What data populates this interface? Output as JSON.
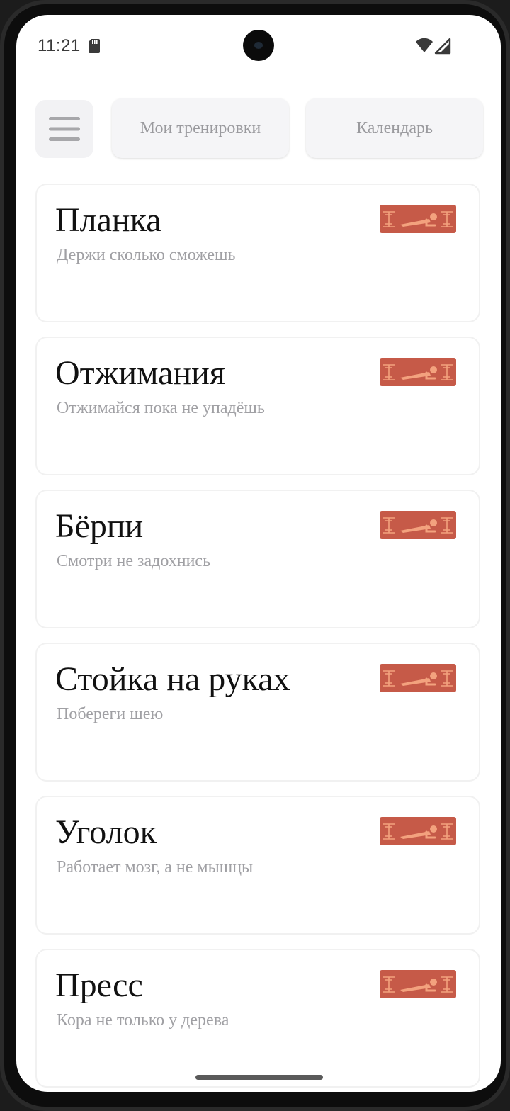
{
  "status_bar": {
    "time": "11:21",
    "icons": [
      "sd-card-icon",
      "wifi-icon",
      "signal-icon"
    ]
  },
  "nav": {
    "menu_icon": "hamburger-menu-icon",
    "tabs": [
      {
        "label": "Мои тренировки"
      },
      {
        "label": "Календарь"
      }
    ]
  },
  "colors": {
    "badge_fill": "#c65a48",
    "badge_line": "#f3a27e",
    "title": "#111111",
    "subtitle": "#a0a0a4",
    "tab_text": "#9a9a9e"
  },
  "workouts": [
    {
      "title": "Планка",
      "subtitle": "Держи сколько сможешь",
      "icon": "plank-exercise-icon"
    },
    {
      "title": "Отжимания",
      "subtitle": "Отжимайся пока не упадёшь",
      "icon": "plank-exercise-icon"
    },
    {
      "title": "Бёрпи",
      "subtitle": "Смотри не задохнись",
      "icon": "plank-exercise-icon"
    },
    {
      "title": "Стойка на руках",
      "subtitle": "Побереги шею",
      "icon": "plank-exercise-icon"
    },
    {
      "title": "Уголок",
      "subtitle": "Работает мозг, а не мышцы",
      "icon": "plank-exercise-icon"
    },
    {
      "title": "Пресс",
      "subtitle": "Кора не только у дерева",
      "icon": "plank-exercise-icon"
    }
  ]
}
